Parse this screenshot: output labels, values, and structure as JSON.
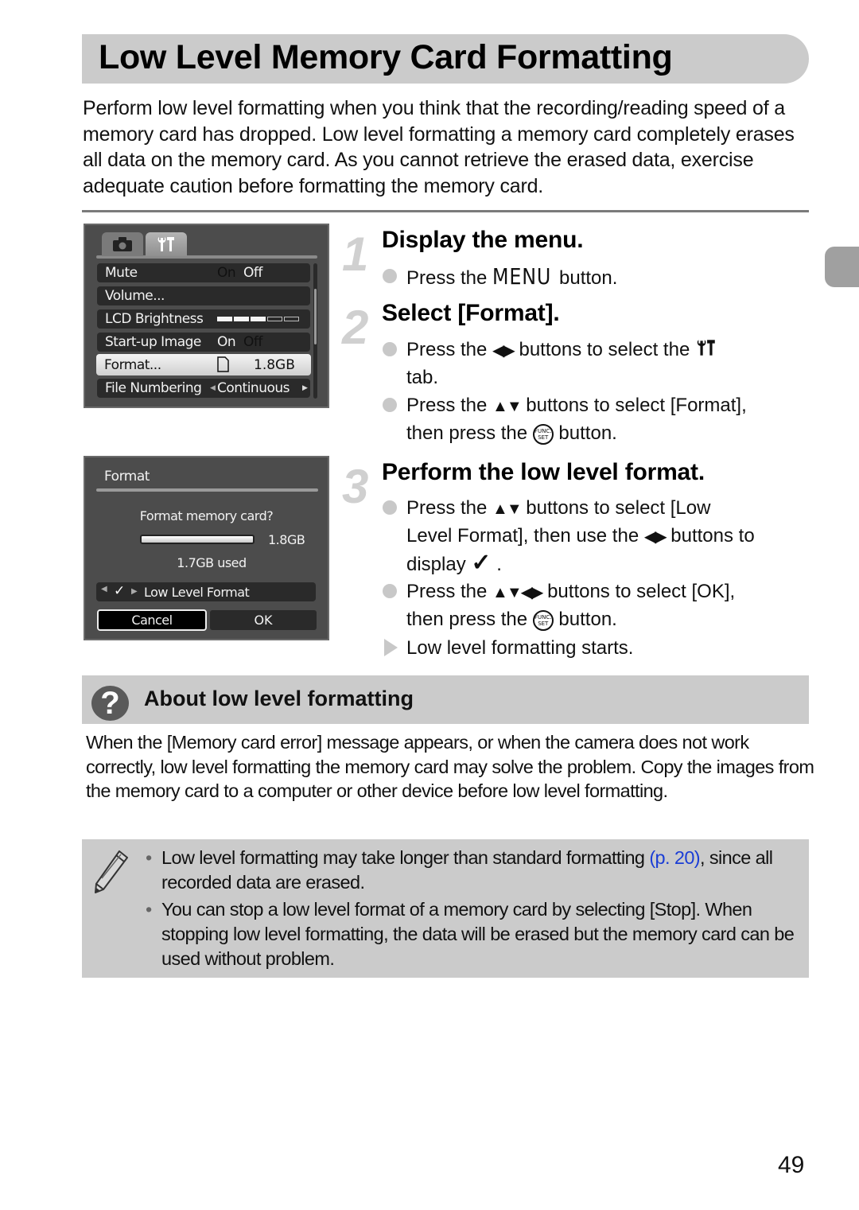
{
  "page": {
    "title": "Low Level Memory Card Formatting",
    "intro": "Perform low level formatting when you think that the recording/reading speed of a memory card has dropped. Low level formatting a memory card completely erases all data on the memory card. As you cannot retrieve the erased data, exercise adequate caution before formatting the memory card.",
    "page_number": "49"
  },
  "screen1": {
    "tabs": [
      {
        "icon": "camera-icon",
        "selected": false
      },
      {
        "icon": "settings-tools-icon",
        "selected": true
      }
    ],
    "rows": [
      {
        "label": "Mute",
        "value_dim": "On",
        "value": "Off"
      },
      {
        "label": "Volume...",
        "value": ""
      },
      {
        "label": "LCD Brightness",
        "brightness_level": 3,
        "brightness_max": 5
      },
      {
        "label": "Start-up Image",
        "value": "On",
        "value_dim": "Off"
      },
      {
        "label": "Format...",
        "value": "1.8GB",
        "selected": true
      },
      {
        "label": "File Numbering",
        "value": "Continuous"
      }
    ]
  },
  "screen2": {
    "title": "Format",
    "question": "Format memory card?",
    "capacity": "1.8GB",
    "used": "1.7GB used",
    "used_fraction": 0.94,
    "low_level_label": "Low Level Format",
    "low_level_checked": true,
    "cancel_label": "Cancel",
    "ok_label": "OK"
  },
  "steps": [
    {
      "number": "1",
      "title": "Display the menu.",
      "bullets": [
        {
          "pre": "Press the ",
          "key": "MENU",
          "post": " button."
        }
      ]
    },
    {
      "number": "2",
      "title": "Select [Format].",
      "bullets": [
        {
          "line1_pre": "Press the ",
          "line1_post": " buttons to select the ",
          "line2": "tab."
        },
        {
          "line1_pre": "Press the ",
          "line1_post": " buttons to select [Format],",
          "line2_pre": "then press the ",
          "line2_post": " button."
        }
      ]
    },
    {
      "number": "3",
      "title": "Perform the low level format.",
      "bullets": [
        {
          "line1_pre": "Press the ",
          "line1_post": " buttons to select [Low",
          "line2_pre": "Level Format], then use the ",
          "line2_post": " buttons to",
          "line3_pre": "display ",
          "line3_post": "."
        },
        {
          "line1_pre": "Press the ",
          "line1_post": " buttons to select [OK],",
          "line2_pre": "then press the ",
          "line2_post": " button."
        }
      ],
      "result": "Low level formatting starts."
    }
  ],
  "func_button": {
    "top": "FUNC.",
    "bottom": "SET"
  },
  "about": {
    "title": "About low level formatting",
    "text": "When the [Memory card error] message appears, or when the camera does not work correctly, low level formatting the memory card may solve the problem. Copy the images from the memory card to a computer or other device before low level formatting."
  },
  "notes": {
    "items": [
      {
        "pre": "Low level formatting may take longer than standard formatting ",
        "link": "(p. 20)",
        "post": ", since all recorded data are erased."
      },
      {
        "pre": "You can stop a low level format of a memory card by selecting [Stop]. When stopping low level formatting, the data will be erased but the memory card can be used without problem."
      }
    ],
    "bullet": "•"
  }
}
